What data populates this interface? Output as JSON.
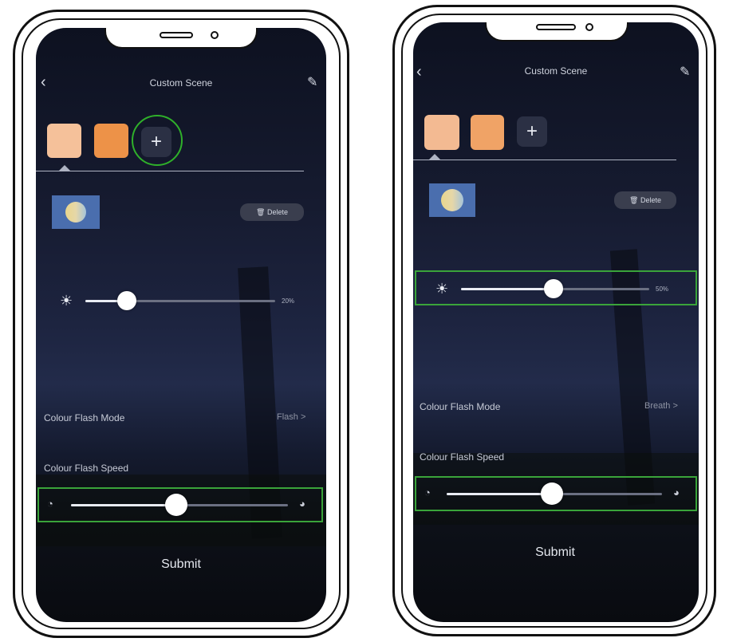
{
  "screens": [
    {
      "header": {
        "title": "Custom Scene",
        "back_icon": "back-chevron-icon",
        "edit_icon": "pencil-icon"
      },
      "swatches": [
        {
          "color": "#f5c19a"
        },
        {
          "color": "#ed9248"
        }
      ],
      "add_label": "+",
      "delete_label": "Delete",
      "brightness": {
        "icon": "sun-icon",
        "value_label": "20%",
        "level": 0.2
      },
      "flash_mode": {
        "label": "Colour Flash Mode",
        "value": "Flash",
        "chevron": ">"
      },
      "flash_speed": {
        "label": "Colour Flash Speed",
        "level": 0.48,
        "slow_icon": "slow-speed-icon",
        "fast_icon": "fast-speed-icon"
      },
      "submit_label": "Submit",
      "highlight_color": "#2fb02a"
    },
    {
      "header": {
        "title": "Custom Scene",
        "back_icon": "back-chevron-icon",
        "edit_icon": "pencil-icon"
      },
      "swatches": [
        {
          "color": "#f3ba92"
        },
        {
          "color": "#f0a366"
        }
      ],
      "add_label": "+",
      "delete_label": "Delete",
      "brightness": {
        "icon": "sun-icon",
        "value_label": "50%",
        "level": 0.5
      },
      "flash_mode": {
        "label": "Colour Flash Mode",
        "value": "Breath",
        "chevron": ">"
      },
      "flash_speed": {
        "label": "Colour Flash Speed",
        "level": 0.48,
        "slow_icon": "slow-speed-icon",
        "fast_icon": "fast-speed-icon"
      },
      "submit_label": "Submit",
      "highlight_color": "#3aa43a"
    }
  ]
}
